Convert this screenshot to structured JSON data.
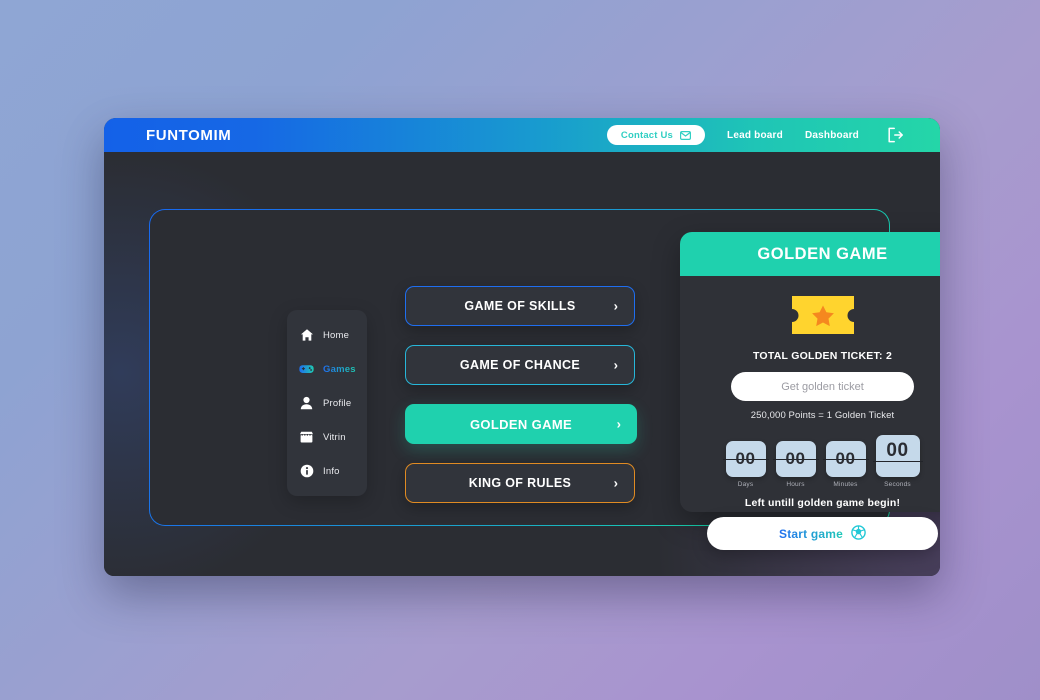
{
  "topbar": {
    "brand": "FUNTOMIM",
    "contact_label": "Contact Us",
    "contact_icon": "envelope-icon",
    "links": [
      {
        "label": "Lead board"
      },
      {
        "label": "Dashboard"
      }
    ],
    "logout_icon": "logout-icon"
  },
  "sidebar": {
    "items": [
      {
        "label": "Home",
        "icon": "home-icon",
        "active": false
      },
      {
        "label": "Games",
        "icon": "gamepad-icon",
        "active": true
      },
      {
        "label": "Profile",
        "icon": "person-icon",
        "active": false
      },
      {
        "label": "Vitrin",
        "icon": "store-icon",
        "active": false
      },
      {
        "label": "Info",
        "icon": "info-icon",
        "active": false
      }
    ]
  },
  "games": {
    "buttons": [
      {
        "label": "GAME OF SKILLS",
        "style": "outline-blue",
        "chevron": "›"
      },
      {
        "label": "GAME OF CHANCE",
        "style": "outline-cyan",
        "chevron": "›"
      },
      {
        "label": "GOLDEN GAME",
        "style": "filled-teal",
        "chevron": "›"
      },
      {
        "label": "KING OF RULES",
        "style": "outline-orange",
        "chevron": "›"
      }
    ]
  },
  "golden_game": {
    "title": "GOLDEN GAME",
    "ticket_icon": "golden-ticket-icon",
    "total_tickets_label": "TOTAL GOLDEN TICKET: 2",
    "input_placeholder": "Get golden ticket",
    "input_value": "",
    "rate_note": "250,000 Points = 1 Golden Ticket",
    "countdown": [
      {
        "value": "00",
        "label": "Days"
      },
      {
        "value": "00",
        "label": "Hours"
      },
      {
        "value": "00",
        "label": "Minutes"
      },
      {
        "value": "00",
        "label": "Seconds"
      }
    ],
    "countdown_note": "Left untill golden game begin!",
    "start_label": "Start game",
    "start_icon": "soccer-ball-icon"
  },
  "colors": {
    "accent_teal": "#1FD1AE",
    "accent_blue": "#1F6EF0",
    "accent_cyan": "#27B7D9",
    "accent_orange": "#E08B23",
    "ticket_yellow": "#FFD42E",
    "ticket_star_orange": "#F5881F",
    "panel_bg": "#2B2D33",
    "card_bg": "#31343B",
    "countdown_box": "#C5D9EA"
  }
}
